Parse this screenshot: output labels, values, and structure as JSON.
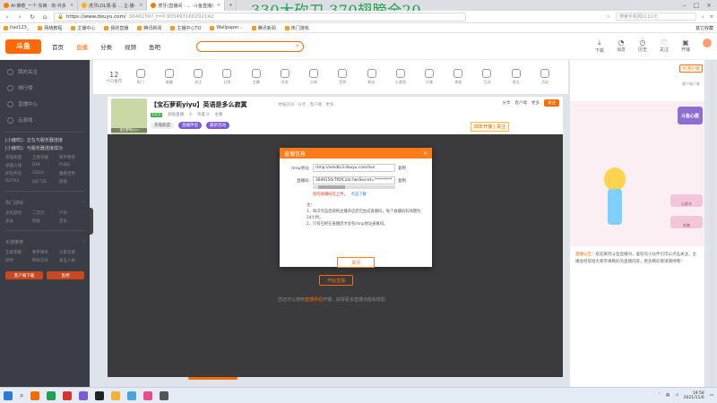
{
  "browser": {
    "tabs": [
      {
        "label": "AI·推荐_一个·东西 · 有·许多"
      },
      {
        "label": "虎牙LOL观·看 ... 主·播·"
      },
      {
        "label": "虎牙(直播间 · ... ·斗鱼直播)",
        "active": true
      }
    ],
    "overlay_banner": "330大砍刀 370翅膀全20",
    "url": "https://www.douyu.com/",
    "url_query": "3646150?_t=0.905497160292142",
    "search_placeholder": "搜索手机网1111元",
    "bookmarks": [
      "hao123_",
      "网络教程",
      "主播中心",
      "我的直播",
      "腾讯新闻",
      "主播中心TO",
      "Wallpaper...",
      "腾讯新闻",
      "热门游戏"
    ],
    "bookmarks_right": "其它收藏"
  },
  "site": {
    "logo": "斗鱼",
    "nav": [
      "首页",
      "直播",
      "分类",
      "视频",
      "鱼吧"
    ],
    "nav_active": 1,
    "header_icons": [
      "下载",
      "消息",
      "历史",
      "关注",
      "开播"
    ]
  },
  "sidebar": {
    "items": [
      "我的关注",
      "排行榜",
      "直播中心",
      "云游戏"
    ],
    "messages": [
      "[小鹿鸣]：正在与服务器连接",
      "[小鹿鸣]：与服务器连接成功"
    ],
    "grid1": [
      "英雄联盟",
      "王者荣耀",
      "和平精英",
      "穿越火线",
      "DNF",
      "PUBG",
      "炉石传说",
      "CSGO",
      "魔兽世界",
      "DOTA2",
      "QQ飞车",
      "颜值"
    ],
    "head2": "热门游戏",
    "grid2": [
      "主机游戏",
      "二次元",
      "户外",
      "美食",
      "科技",
      "音乐"
    ],
    "head3": "手游推荐",
    "grid3": [
      "王者荣耀",
      "和平精英",
      "火影忍者",
      "原神",
      "明日方舟",
      "第五人格"
    ],
    "buttons": [
      "客户端下载",
      "鱼吧"
    ]
  },
  "categories": {
    "date_day": "12",
    "date_label": "今日推荐",
    "items": [
      "热门",
      "收藏",
      "关注",
      "日常",
      "主播",
      "任务",
      "分享",
      "签到",
      "粉丝",
      "小游戏",
      "大咖",
      "贵族",
      "互动",
      "鱼丸",
      "活动",
      "更多",
      "礼物"
    ]
  },
  "room": {
    "title": "【宝石萝莉yiyu】英语是多么寂寞",
    "title_sub": "举报房间 · 分享 · 客户端 · 更多",
    "badge": "Lv.5",
    "meta": [
      "颜值直播",
      "4",
      "热度 0",
      "主播"
    ],
    "tags": [
      "直播伴侣",
      "最新活动"
    ],
    "tag_gray": "英雄联盟",
    "avatar_caption": "宝石萝莉yiyu",
    "follow": "关注",
    "right_items": [
      "分享",
      "客户端",
      "更多"
    ],
    "live_tag": "四年开播 | 关注"
  },
  "modal": {
    "title": "直播信息",
    "close": "×",
    "rtmp_label": "rtmp地址:",
    "rtmp_value": "rtmp://sendtc3.douyu.com/live",
    "code_label": "直播码:",
    "code_value": "3646150rTfOfCzVc?wsSecret=*********",
    "copy": "复制",
    "warning": "您的直播码已上传，",
    "warning_link": "点击了解",
    "notes_head": "注：",
    "notes": [
      "1、每次点击后即将主播开启后已生成直播码，每个直播码有效期为24小时。",
      "2、只有已经在直播后才会有rtmp地址直推码。"
    ],
    "button": "关闭"
  },
  "player": {
    "start_button": "开始直播",
    "hint_prefix": "您还可以使用",
    "hint_link": "直播伴侣",
    "hint_suffix": "开播，获得更多直播功能和体验"
  },
  "right_panel": {
    "top_button": "PC客户端",
    "top_link": "客户端下载",
    "banner_title": "斗鱼心愿",
    "gifts": [
      "心愿卡",
      "礼物"
    ],
    "text_label": "直播公告：",
    "text": "欢迎来到斗鱼直播间，喜欢的小伙伴们可以点击关注，主播会经常给大家带来精彩的直播内容，更多精彩敬请期待哦！"
  },
  "taskbar": {
    "time": "19:58",
    "date": "2021/11/6",
    "colors": [
      "#2e7bd6",
      "#ff6a00",
      "#22a050",
      "#d9342b",
      "#7b5bd6",
      "#222222",
      "#f2b233",
      "#4aa3df",
      "#e84c8a",
      "#555555"
    ]
  }
}
